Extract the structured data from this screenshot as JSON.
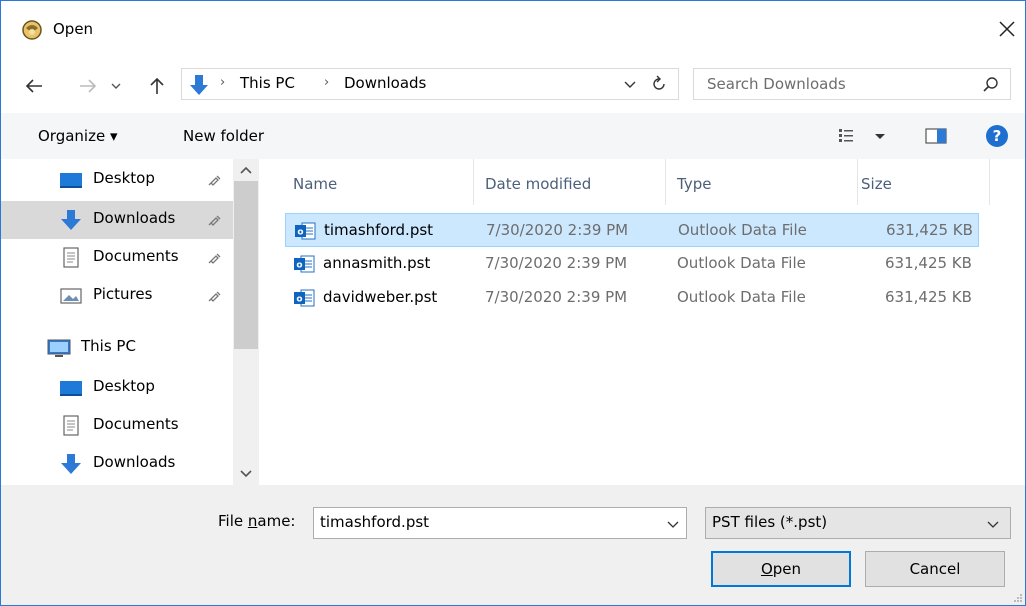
{
  "dialog": {
    "title": "Open"
  },
  "address": {
    "crumbs": [
      "This PC",
      "Downloads"
    ],
    "search_placeholder": "Search Downloads"
  },
  "toolbar": {
    "organize_label": "Organize ▾",
    "new_folder_label": "New folder"
  },
  "nav": {
    "items": [
      {
        "label": "Desktop",
        "icon": "desktop-folder-icon",
        "pinned": true
      },
      {
        "label": "Downloads",
        "icon": "downloads-arrow-icon",
        "pinned": true,
        "selected": true
      },
      {
        "label": "Documents",
        "icon": "documents-icon",
        "pinned": true
      },
      {
        "label": "Pictures",
        "icon": "pictures-icon",
        "pinned": true
      },
      {
        "label": "This PC",
        "icon": "computer-icon"
      },
      {
        "label": "Desktop",
        "icon": "desktop-folder-icon"
      },
      {
        "label": "Documents",
        "icon": "documents-icon"
      },
      {
        "label": "Downloads",
        "icon": "downloads-arrow-icon"
      }
    ]
  },
  "files": {
    "columns": [
      "Name",
      "Date modified",
      "Type",
      "Size"
    ],
    "rows": [
      {
        "name": "timashford.pst",
        "date": "7/30/2020 2:39 PM",
        "type": "Outlook Data File",
        "size": "631,425 KB",
        "selected": true
      },
      {
        "name": "annasmith.pst",
        "date": "7/30/2020 2:39 PM",
        "type": "Outlook Data File",
        "size": "631,425 KB"
      },
      {
        "name": "davidweber.pst",
        "date": "7/30/2020 2:39 PM",
        "type": "Outlook Data File",
        "size": "631,425 KB"
      }
    ]
  },
  "footer": {
    "file_name_label": "File name:",
    "file_name_value": "timashford.pst",
    "file_type_value": "PST files (*.pst)",
    "open_label": "Open",
    "cancel_label": "Cancel"
  },
  "colors": {
    "accent": "#0078d7",
    "selection": "#cce8ff",
    "column_header": "#4c607a"
  }
}
